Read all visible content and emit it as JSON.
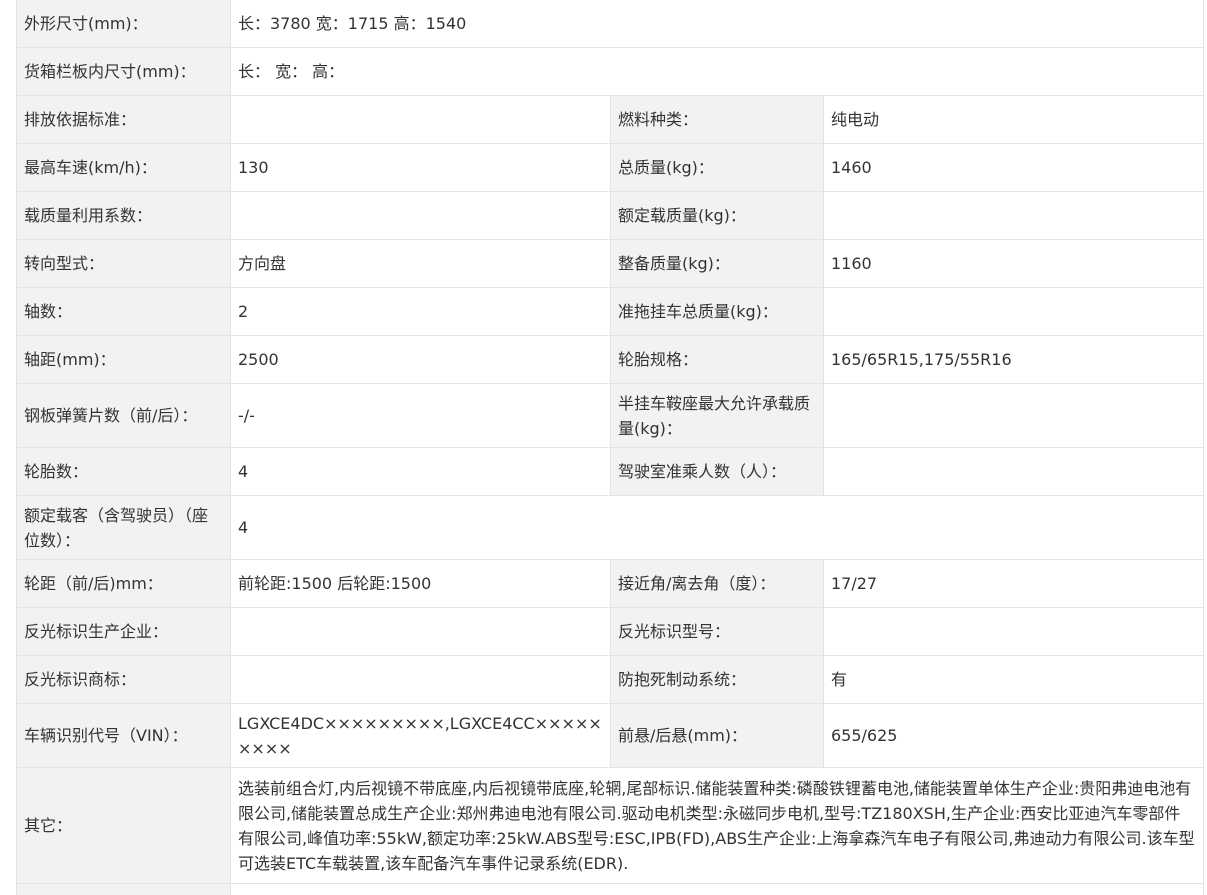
{
  "rows": [
    {
      "label": "外形尺寸(mm)：",
      "value": "长：3780 宽：1715 高：1540"
    },
    {
      "label": "货箱栏板内尺寸(mm)：",
      "value": "长： 宽： 高："
    },
    {
      "label": "排放依据标准：",
      "value": "",
      "label2": "燃料种类：",
      "value2": "纯电动"
    },
    {
      "label": "最高车速(km/h)：",
      "value": "130",
      "label2": "总质量(kg)：",
      "value2": "1460"
    },
    {
      "label": "载质量利用系数：",
      "value": "",
      "label2": "额定载质量(kg)：",
      "value2": ""
    },
    {
      "label": "转向型式：",
      "value": "方向盘",
      "label2": "整备质量(kg)：",
      "value2": "1160"
    },
    {
      "label": "轴数：",
      "value": "2",
      "label2": "准拖挂车总质量(kg)：",
      "value2": ""
    },
    {
      "label": "轴距(mm)：",
      "value": "2500",
      "label2": "轮胎规格：",
      "value2": "165/65R15,175/55R16"
    },
    {
      "label": "钢板弹簧片数（前/后）：",
      "value": "-/-",
      "label2": "半挂车鞍座最大允许承载质量(kg)：",
      "value2": ""
    },
    {
      "label": "轮胎数：",
      "value": "4",
      "label2": "驾驶室准乘人数（人）：",
      "value2": ""
    },
    {
      "label": "额定载客（含驾驶员）（座位数）：",
      "value": "4"
    },
    {
      "label": "轮距（前/后)mm：",
      "value": "前轮距:1500 后轮距:1500",
      "label2": "接近角/离去角（度）：",
      "value2": "17/27"
    },
    {
      "label": "反光标识生产企业：",
      "value": "",
      "label2": "反光标识型号：",
      "value2": ""
    },
    {
      "label": "反光标识商标：",
      "value": "",
      "label2": "防抱死制动系统：",
      "value2": "有"
    },
    {
      "label": "车辆识别代号（VIN）：",
      "value": "LGXCE4DC×××××××××,LGXCE4CC×××××××××",
      "label2": "前悬/后悬(mm)：",
      "value2": "655/625"
    },
    {
      "label": "其它：",
      "value": "选装前组合灯,内后视镜不带底座,内后视镜带底座,轮辋,尾部标识.储能装置种类:磷酸铁锂蓄电池,储能装置单体生产企业:贵阳弗迪电池有限公司,储能装置总成生产企业:郑州弗迪电池有限公司.驱动电机类型:永磁同步电机,型号:TZ180XSH,生产企业:西安比亚迪汽车零部件有限公司,峰值功率:55kW,额定功率:25kW.ABS型号:ESC,IPB(FD),ABS生产企业:上海拿森汽车电子有限公司,弗迪动力有限公司.该车型可选装ETC车载装置,该车配备汽车事件记录系统(EDR)."
    }
  ]
}
